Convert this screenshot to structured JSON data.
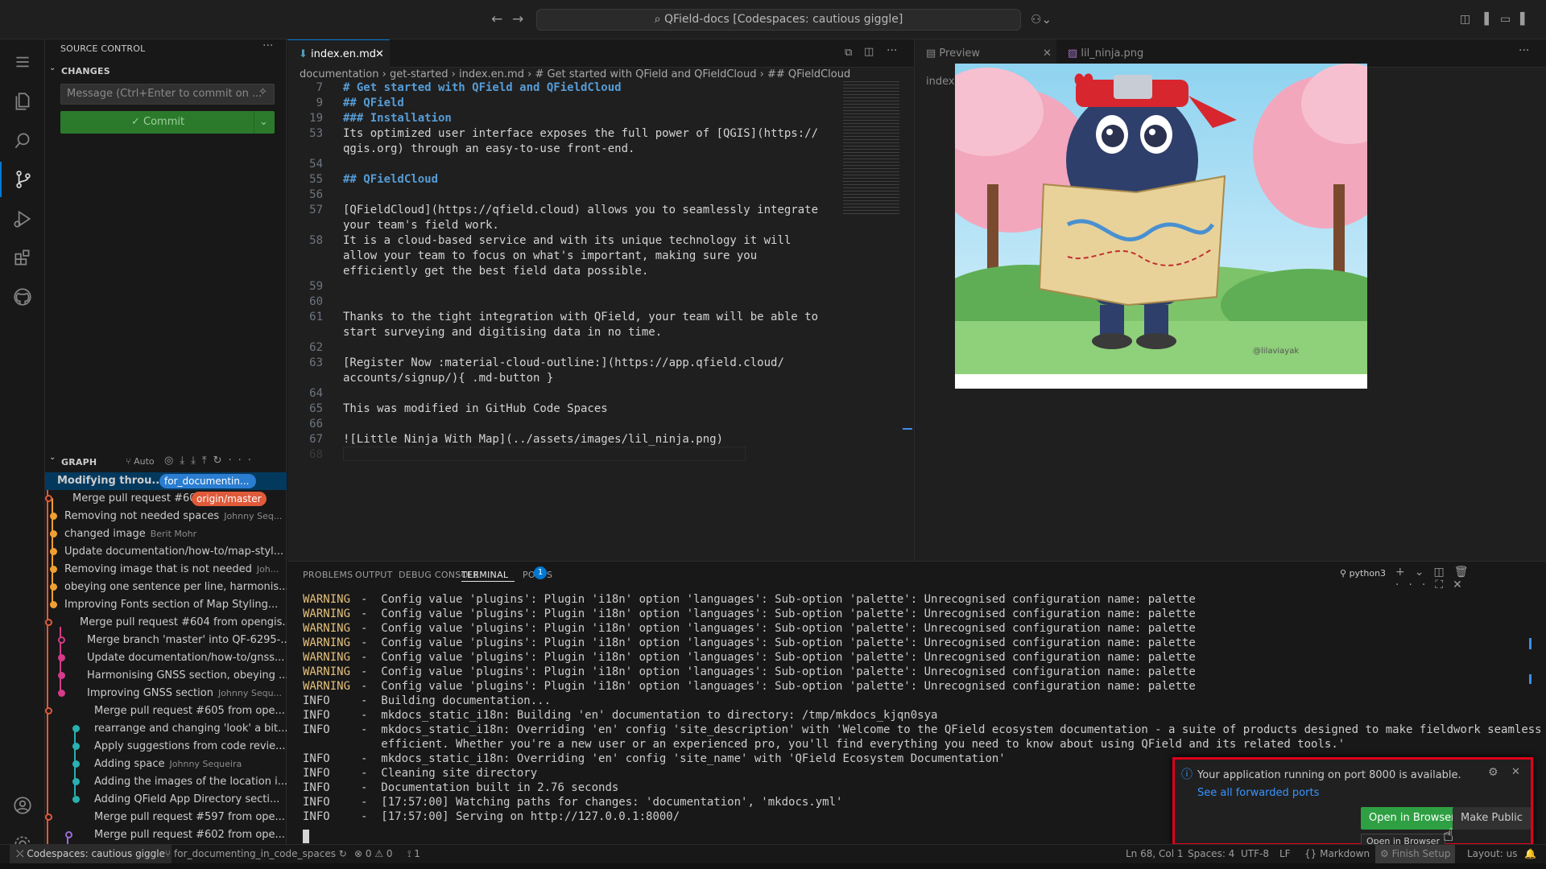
{
  "title_bar": {
    "command_center": "QField-docs [Codespaces: cautious giggle]"
  },
  "sidebar": {
    "title": "SOURCE CONTROL",
    "changes_label": "CHANGES",
    "message_placeholder": "Message (Ctrl+Enter to commit on ...",
    "commit_label": "✓ Commit",
    "graph_label": "GRAPH",
    "graph_auto": "Auto",
    "graph": [
      {
        "text": "Modifying throu...",
        "author": "",
        "badge": "for_documentin..."
      },
      {
        "text": "Merge pull request #60...",
        "author": "",
        "badge": "origin/master"
      },
      {
        "text": "Removing not needed spaces",
        "author": "Johnny Seq..."
      },
      {
        "text": "changed image",
        "author": "Berit Mohr"
      },
      {
        "text": "Update documentation/how-to/map-styl...",
        "author": ""
      },
      {
        "text": "Removing image that is not needed",
        "author": "Joh..."
      },
      {
        "text": "obeying one sentence per line, harmonis...",
        "author": ""
      },
      {
        "text": "Improving Fonts section of Map Styling...",
        "author": ""
      },
      {
        "text": "Merge pull request #604 from opengis...",
        "author": ""
      },
      {
        "text": "Merge branch 'master' into QF-6295-...",
        "author": ""
      },
      {
        "text": "Update documentation/how-to/gnss...",
        "author": ""
      },
      {
        "text": "Harmonising GNSS section, obeying ...",
        "author": ""
      },
      {
        "text": "Improving GNSS section",
        "author": "Johnny Sequ..."
      },
      {
        "text": "Merge pull request #605 from ope...",
        "author": ""
      },
      {
        "text": "rearrange and changing 'look' a bit...",
        "author": ""
      },
      {
        "text": "Apply suggestions from code revie...",
        "author": ""
      },
      {
        "text": "Adding space",
        "author": "Johnny Sequeira"
      },
      {
        "text": "Adding the images of the location i...",
        "author": ""
      },
      {
        "text": "Adding QField App Directory secti...",
        "author": ""
      },
      {
        "text": "Merge pull request #597 from ope...",
        "author": ""
      },
      {
        "text": "Merge pull request #602 from ope...",
        "author": ""
      }
    ]
  },
  "editor": {
    "tab": "index.en.md",
    "breadcrumbs": [
      "documentation",
      "get-started",
      "index.en.md",
      "# Get started with QField and QFieldCloud",
      "## QFieldCloud"
    ],
    "lines": [
      {
        "n": "7",
        "t": "# Get started with QField and QFieldCloud"
      },
      {
        "n": "9",
        "t": "## QField"
      },
      {
        "n": "19",
        "t": "### Installation"
      },
      {
        "n": "53",
        "t": "Its optimized user interface exposes the full power of [QGIS](https://"
      },
      {
        "n": "",
        "t": "qgis.org) through an easy-to-use front-end."
      },
      {
        "n": "54",
        "t": ""
      },
      {
        "n": "55",
        "t": "## QFieldCloud"
      },
      {
        "n": "56",
        "t": ""
      },
      {
        "n": "57",
        "t": "[QFieldCloud](https://qfield.cloud) allows you to seamlessly integrate"
      },
      {
        "n": "",
        "t": "your team's field work."
      },
      {
        "n": "58",
        "t": "It is a cloud-based service and with its unique technology it will"
      },
      {
        "n": "",
        "t": "allow your team to focus on what's important, making sure you"
      },
      {
        "n": "",
        "t": "efficiently get the best field data possible."
      },
      {
        "n": "59",
        "t": ""
      },
      {
        "n": "60",
        "t": ""
      },
      {
        "n": "61",
        "t": "Thanks to the tight integration with QField, your team will be able to"
      },
      {
        "n": "",
        "t": "start surveying and digitising data in no time."
      },
      {
        "n": "62",
        "t": ""
      },
      {
        "n": "63",
        "t": "[Register Now :material-cloud-outline:](https://app.qfield.cloud/"
      },
      {
        "n": "",
        "t": "accounts/signup/){ .md-button }"
      },
      {
        "n": "64",
        "t": ""
      },
      {
        "n": "65",
        "t": "This was modified in GitHub Code Spaces"
      },
      {
        "n": "66",
        "t": ""
      },
      {
        "n": "67",
        "t": "![Little Ninja With Map](../assets/images/lil_ninja.png)"
      },
      {
        "n": "68",
        "t": ""
      }
    ]
  },
  "preview": {
    "tab1": "Preview index.en.md",
    "tab2": "lil_ninja.png",
    "signature": "@lilaviayak"
  },
  "panel": {
    "tabs": [
      "PROBLEMS",
      "OUTPUT",
      "DEBUG CONSOLE",
      "TERMINAL",
      "PORTS"
    ],
    "ports_count": "1",
    "shell": "python3",
    "terminal": [
      {
        "lvl": "WARNING",
        "msg": "Config value 'plugins': Plugin 'i18n' option 'languages': Sub-option 'palette': Unrecognised configuration name: palette"
      },
      {
        "lvl": "WARNING",
        "msg": "Config value 'plugins': Plugin 'i18n' option 'languages': Sub-option 'palette': Unrecognised configuration name: palette"
      },
      {
        "lvl": "WARNING",
        "msg": "Config value 'plugins': Plugin 'i18n' option 'languages': Sub-option 'palette': Unrecognised configuration name: palette"
      },
      {
        "lvl": "WARNING",
        "msg": "Config value 'plugins': Plugin 'i18n' option 'languages': Sub-option 'palette': Unrecognised configuration name: palette"
      },
      {
        "lvl": "WARNING",
        "msg": "Config value 'plugins': Plugin 'i18n' option 'languages': Sub-option 'palette': Unrecognised configuration name: palette"
      },
      {
        "lvl": "WARNING",
        "msg": "Config value 'plugins': Plugin 'i18n' option 'languages': Sub-option 'palette': Unrecognised configuration name: palette"
      },
      {
        "lvl": "WARNING",
        "msg": "Config value 'plugins': Plugin 'i18n' option 'languages': Sub-option 'palette': Unrecognised configuration name: palette"
      },
      {
        "lvl": "INFO",
        "msg": "Building documentation..."
      },
      {
        "lvl": "INFO",
        "msg": "mkdocs_static_i18n: Building 'en' documentation to directory: /tmp/mkdocs_kjqn0sya"
      },
      {
        "lvl": "INFO",
        "msg": "mkdocs_static_i18n: Overriding 'en' config 'site_description' with 'Welcome to the QField ecosystem documentation - a suite of products designed to make fieldwork seamless and"
      },
      {
        "lvl": "",
        "msg": "efficient. Whether you're a new user or an experienced pro, you'll find everything you need to know about using QField and its related tools.'"
      },
      {
        "lvl": "INFO",
        "msg": "mkdocs_static_i18n: Overriding 'en' config 'site_name' with 'QField Ecosystem Documentation'"
      },
      {
        "lvl": "INFO",
        "msg": "Cleaning site directory"
      },
      {
        "lvl": "INFO",
        "msg": "Documentation built in 2.76 seconds"
      },
      {
        "lvl": "INFO",
        "msg": "[17:57:00] Watching paths for changes: 'documentation', 'mkdocs.yml'"
      },
      {
        "lvl": "INFO",
        "msg": "[17:57:00] Serving on http://127.0.0.1:8000/"
      }
    ]
  },
  "notification": {
    "message": "Your application running on port 8000 is available.",
    "link": "See all forwarded ports",
    "primary_button": "Open in Browser",
    "secondary_button": "Make Public",
    "tooltip": "Open in Browser"
  },
  "status_bar": {
    "remote": "Codespaces: cautious giggle",
    "branch": "for_documenting_in_code_spaces",
    "problems": "⊗ 0 ⚠ 0",
    "ports": "1",
    "cursor": "Ln 68, Col 1",
    "spaces": "Spaces: 4",
    "encoding": "UTF-8",
    "eol": "LF",
    "language": "Markdown",
    "finish_setup": "Finish Setup",
    "layout": "Layout: us"
  }
}
